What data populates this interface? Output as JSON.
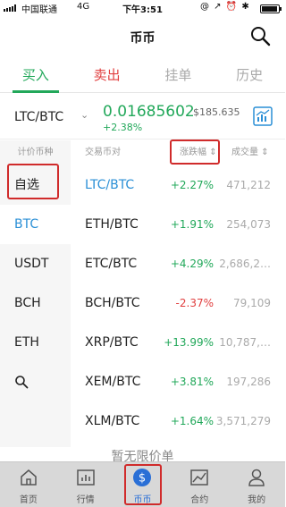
{
  "statusbar": {
    "carrier": "中国联通",
    "network": "4G",
    "time": "下午3:51",
    "sys_icons": "@ ↗ ⏰ ✱"
  },
  "header": {
    "title": "币币",
    "search_icon": "search-icon"
  },
  "tabs": [
    {
      "label": "买入"
    },
    {
      "label": "卖出"
    },
    {
      "label": "挂单"
    },
    {
      "label": "历史"
    }
  ],
  "pair": {
    "name": "LTC/BTC",
    "chevron": "⌄",
    "price": "0.01685602",
    "usd_price": "$185.635",
    "change": "+2.38%"
  },
  "left_menu": {
    "header": "计价币种",
    "items": [
      {
        "label": "自选"
      },
      {
        "label": "BTC"
      },
      {
        "label": "USDT"
      },
      {
        "label": "BCH"
      },
      {
        "label": "ETH"
      }
    ]
  },
  "list": {
    "headers": {
      "pair": "交易币对",
      "change": "涨跌幅",
      "volume": "成交量"
    },
    "rows": [
      {
        "pair": "LTC/BTC",
        "change": "+2.27%",
        "volume": "471,212",
        "dir": "up"
      },
      {
        "pair": "ETH/BTC",
        "change": "+1.91%",
        "volume": "254,073",
        "dir": "up"
      },
      {
        "pair": "ETC/BTC",
        "change": "+4.29%",
        "volume": "2,686,2…",
        "dir": "up"
      },
      {
        "pair": "BCH/BTC",
        "change": "-2.37%",
        "volume": "79,109",
        "dir": "down"
      },
      {
        "pair": "XRP/BTC",
        "change": "+13.99%",
        "volume": "10,787,…",
        "dir": "up"
      },
      {
        "pair": "XEM/BTC",
        "change": "+3.81%",
        "volume": "197,286",
        "dir": "up"
      },
      {
        "pair": "XLM/BTC",
        "change": "+1.64%",
        "volume": "3,571,279",
        "dir": "up"
      }
    ]
  },
  "empty_hint": "暂无限价单",
  "bottom_nav": [
    {
      "label": "首页"
    },
    {
      "label": "行情"
    },
    {
      "label": "币币"
    },
    {
      "label": "合约"
    },
    {
      "label": "我的"
    }
  ],
  "colors": {
    "green": "#22a85a",
    "red": "#e14040",
    "blue": "#2a8fd6",
    "highlight": "#d02b2b"
  }
}
